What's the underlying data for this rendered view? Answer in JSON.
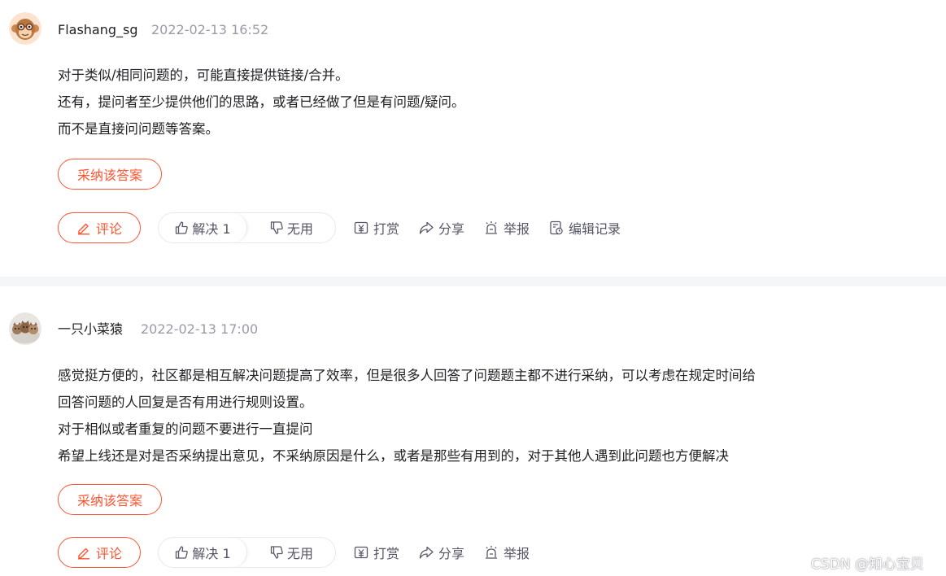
{
  "answers": [
    {
      "username": "Flashang_sg",
      "time": "2022-02-13 16:52",
      "lines": [
        "对于类似/相同问题的，可能直接提供链接/合并。",
        "还有，提问者至少提供他们的思路，或者已经做了但是有问题/疑问。",
        "而不是直接问问题等答案。"
      ],
      "accept_label": "采纳该答案",
      "comment_label": "评论",
      "solve_label": "解决 1",
      "useless_label": "无用",
      "reward_label": "打赏",
      "share_label": "分享",
      "report_label": "举报",
      "history_label": "编辑记录"
    },
    {
      "username": "一只小菜猿",
      "time": "2022-02-13 17:00",
      "lines": [
        "感觉挺方便的，社区都是相互解决问题提高了效率，但是很多人回答了问题题主都不进行采纳，可以考虑在规定时间给",
        "回答问题的人回复是否有用进行规则设置。",
        "对于相似或者重复的问题不要进行一直提问",
        "希望上线还是对是否采纳提出意见，不采纳原因是什么，或者是那些有用到的，对于其他人遇到此问题也方便解决"
      ],
      "accept_label": "采纳该答案",
      "comment_label": "评论",
      "solve_label": "解决 1",
      "useless_label": "无用",
      "reward_label": "打赏",
      "share_label": "分享",
      "report_label": "举报"
    }
  ],
  "watermark": "CSDN @知心宝贝",
  "colors": {
    "accent": "#fc5531",
    "muted": "#999aaa",
    "action": "#555666"
  },
  "icons": [
    "monkey-avatar",
    "cats-avatar",
    "pencil-icon",
    "thumb-up-icon",
    "thumb-down-icon",
    "reward-icon",
    "share-icon",
    "report-icon",
    "history-icon"
  ]
}
